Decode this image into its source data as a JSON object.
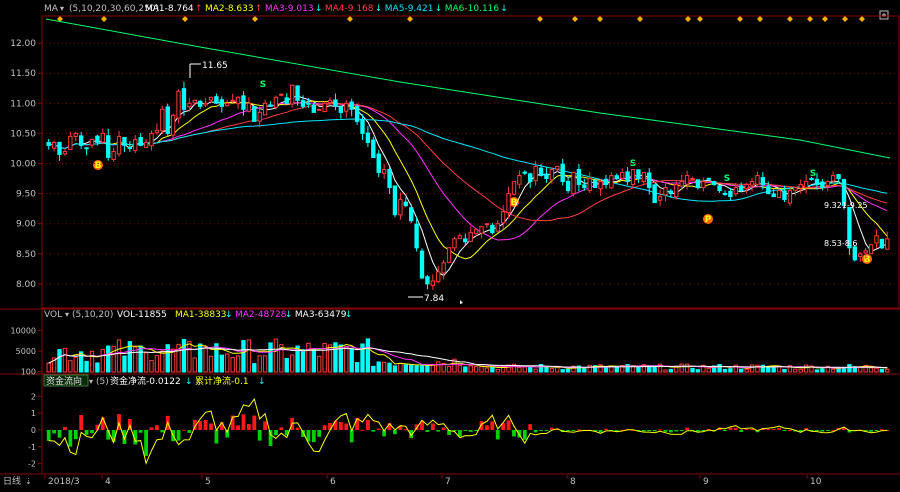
{
  "price_panel": {
    "indicator_name": "MA",
    "params": "(5,10,20,30,60,250)",
    "ma_labels": [
      {
        "text": "MA1-8.764",
        "arrow": "↑",
        "color": "#ffffff"
      },
      {
        "text": "MA2-8.633",
        "arrow": "↑",
        "color": "#ffff00"
      },
      {
        "text": "MA3-9.013",
        "arrow": "↓",
        "color": "#ff33ff"
      },
      {
        "text": "MA4-9.168",
        "arrow": "↓",
        "color": "#ff4040"
      },
      {
        "text": "MA5-9.421",
        "arrow": "↓",
        "color": "#00e5ff"
      },
      {
        "text": "MA6-10.116",
        "arrow": "↓",
        "color": "#00ff66"
      }
    ],
    "ylim": [
      7.6,
      12.45
    ],
    "y_ticks": [
      "12.00",
      "11.50",
      "11.00",
      "10.50",
      "10.00",
      "9.50",
      "9.00",
      "8.50",
      "8.00"
    ],
    "high_label": "11.65",
    "low_label": "7.84",
    "mid_label_1": "9.321-9.25",
    "mid_label_2": "8.53-8.6",
    "signal_marks": [
      "S",
      "B",
      "S",
      "B",
      "S",
      "P",
      "S",
      "B"
    ]
  },
  "volume_panel": {
    "indicator_name": "VOL",
    "params": "(5,10,20)",
    "vol_label": "VOL-11855",
    "ma_labels": [
      {
        "text": "MA1-38833",
        "arrow": "↓",
        "color": "#ffff00"
      },
      {
        "text": "MA2-48728",
        "arrow": "↓",
        "color": "#ff33ff"
      },
      {
        "text": "MA3-63479",
        "arrow": "↓",
        "color": "#ffffff"
      }
    ],
    "y_ticks": [
      "10000",
      "5000",
      "100"
    ]
  },
  "flow_panel": {
    "indicator_name": "资金流向",
    "params": "(5)",
    "label1": "资金净流-0.0122",
    "label1_arrow": "↓",
    "label2": "累计净流-0.1",
    "label2_arrow": "↓",
    "y_ticks": [
      "2",
      "1",
      "0",
      "-1",
      "-2"
    ]
  },
  "footer": {
    "period_label": "日线",
    "months": [
      "2018/3",
      "4",
      "5",
      "6",
      "7",
      "8",
      "9",
      "10"
    ]
  },
  "colors": {
    "up": "#ff3b3b",
    "down": "#00ffff",
    "grid": "#8b0000",
    "axis_text": "#c0c0c0"
  },
  "chart_data": {
    "type": "candlestick",
    "title": "",
    "x": "trading days (2018/3 – 2018/10)",
    "ylim": [
      7.6,
      12.45
    ],
    "close_series": [
      10.3,
      10.35,
      10.15,
      10.2,
      10.45,
      10.5,
      10.3,
      10.25,
      10.4,
      10.35,
      10.5,
      10.1,
      10.2,
      10.45,
      10.3,
      10.25,
      10.4,
      10.3,
      10.35,
      10.5,
      10.55,
      10.9,
      10.5,
      10.8,
      11.2,
      10.9,
      11.0,
      11.05,
      10.95,
      11.0,
      11.1,
      11.0,
      10.95,
      11.0,
      11.05,
      11.1,
      10.9,
      11.0,
      10.7,
      10.85,
      11.0,
      10.95,
      11.1,
      11.15,
      11.0,
      11.3,
      11.05,
      10.95,
      11.0,
      10.85,
      10.9,
      11.0,
      11.05,
      10.95,
      10.85,
      11.0,
      10.9,
      10.7,
      10.5,
      10.35,
      10.1,
      9.85,
      9.9,
      9.6,
      9.15,
      9.4,
      9.3,
      9.05,
      8.6,
      8.1,
      8.0,
      8.05,
      8.2,
      8.35,
      8.6,
      8.75,
      8.8,
      8.7,
      8.85,
      8.9,
      8.95,
      9.0,
      8.85,
      9.0,
      9.2,
      9.5,
      9.7,
      9.8,
      9.85,
      9.7,
      9.95,
      9.8,
      9.75,
      9.9,
      9.95,
      9.7,
      9.55,
      9.85,
      9.65,
      9.6,
      9.75,
      9.6,
      9.7,
      9.65,
      9.8,
      9.75,
      9.85,
      9.7,
      9.9,
      9.75,
      9.85,
      9.6,
      9.35,
      9.45,
      9.6,
      9.5,
      9.65,
      9.7,
      9.8,
      9.75,
      9.6,
      9.7,
      9.75,
      9.65,
      9.55,
      9.5,
      9.45,
      9.6,
      9.55,
      9.65,
      9.7,
      9.8,
      9.65,
      9.5,
      9.45,
      9.55,
      9.4,
      9.55,
      9.6,
      9.65,
      9.7,
      9.75,
      9.65,
      9.6,
      9.7,
      9.8,
      9.75,
      9.3,
      8.6,
      8.4,
      8.5,
      8.55,
      8.65,
      8.8,
      8.6,
      8.75
    ]
  }
}
